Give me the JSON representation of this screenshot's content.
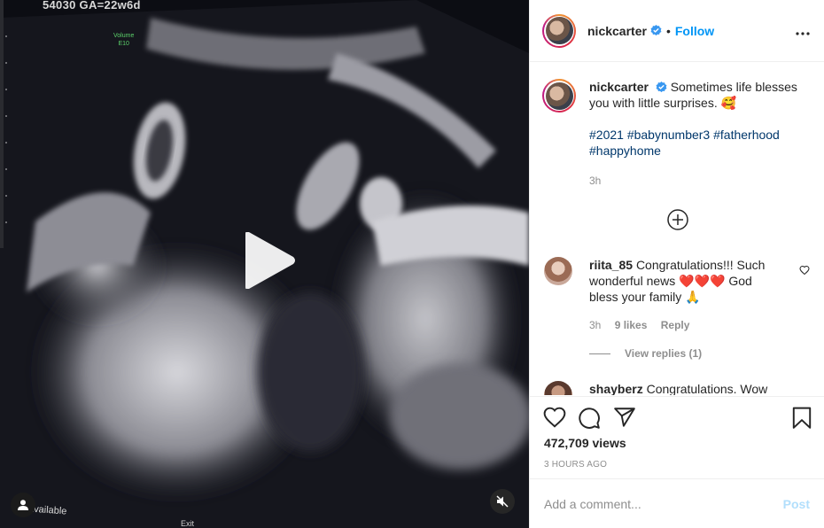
{
  "media": {
    "overlay_top": "54030  GA=22w6d",
    "volume_label": "Volume",
    "volume_value": "E10",
    "overlay_bottom": "available",
    "overlay_exit": "Exit",
    "icons": {
      "play": "play-icon",
      "user_tag": "user-icon",
      "mute": "muted-speaker-icon"
    }
  },
  "header": {
    "username": "nickcarter",
    "separator": "•",
    "follow_label": "Follow",
    "verified": true
  },
  "caption": {
    "username": "nickcarter",
    "text": "Sometimes life blesses you with little surprises. 🥰",
    "hashtags": "#2021 #babynumber3 #fatherhood #happyhome",
    "time": "3h"
  },
  "comments": [
    {
      "username": "riita_85",
      "text": "Congratulations!!! Such wonderful news ❤️❤️❤️ God bless your family 🙏",
      "time": "3h",
      "likes": "9 likes",
      "reply_label": "Reply",
      "view_replies": "View replies (1)"
    },
    {
      "username": "shayberz",
      "text": "Congratulations. Wow"
    }
  ],
  "stats": {
    "views": "472,709 views",
    "ago": "3 HOURS AGO"
  },
  "add_comment": {
    "placeholder": "Add a comment...",
    "post_label": "Post"
  },
  "colors": {
    "accent": "#0095f6",
    "link": "#00376b",
    "muted": "#8e8e8e",
    "post_disabled": "#b2dffc",
    "heart_red": "#e0245e"
  }
}
